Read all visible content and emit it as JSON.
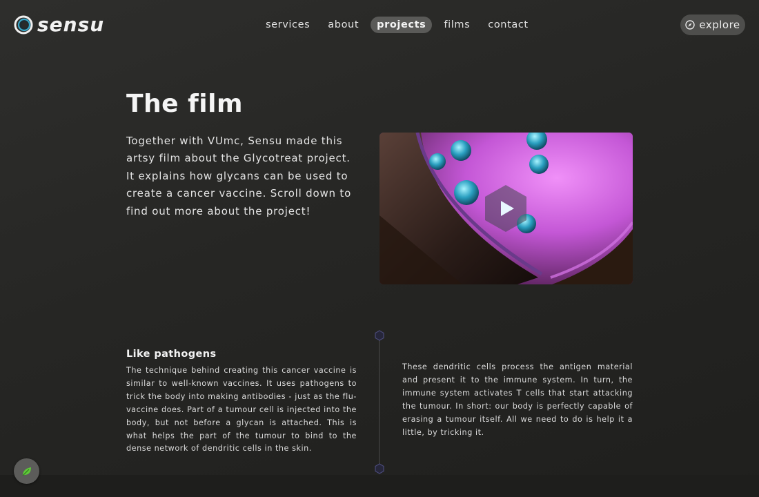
{
  "brand": {
    "name": "sensu"
  },
  "nav": {
    "items": [
      {
        "label": "services"
      },
      {
        "label": "about"
      },
      {
        "label": "projects"
      },
      {
        "label": "films"
      },
      {
        "label": "contact"
      }
    ],
    "active": "projects"
  },
  "explore": {
    "label": "explore",
    "icon": "compass-icon"
  },
  "film": {
    "title": "The film",
    "intro": "Together with VUmc, Sensu made this artsy film about the Glycotreat project. It explains how glycans can be used to create a cancer vaccine. Scroll down to find out more about the project!",
    "video": {
      "icon": "play-icon"
    }
  },
  "pathogens": {
    "heading": "Like pathogens",
    "left_text": "The technique behind creating this cancer vaccine is similar to well-known vaccines. It uses pathogens to trick the body into making antibodies - just as the flu-vaccine does. Part of a tumour cell is injected into the body, but not before a glycan is attached. This is what helps the part of the tumour to bind to the dense network of dendritic cells in the skin.",
    "right_text": "These dendritic cells process the antigen material and present it to the immune system. In turn, the immune system activates T cells that start attacking the tumour. In short: our body is perfectly capable of erasing a tumour itself. All we need to do is help it a little, by tricking it."
  },
  "floating": {
    "icon": "leaf-icon"
  },
  "colors": {
    "accent_pink": "#c85ad8",
    "nav_active_bg": "#5a5a58",
    "hex_marker": "#3a3a5a"
  }
}
